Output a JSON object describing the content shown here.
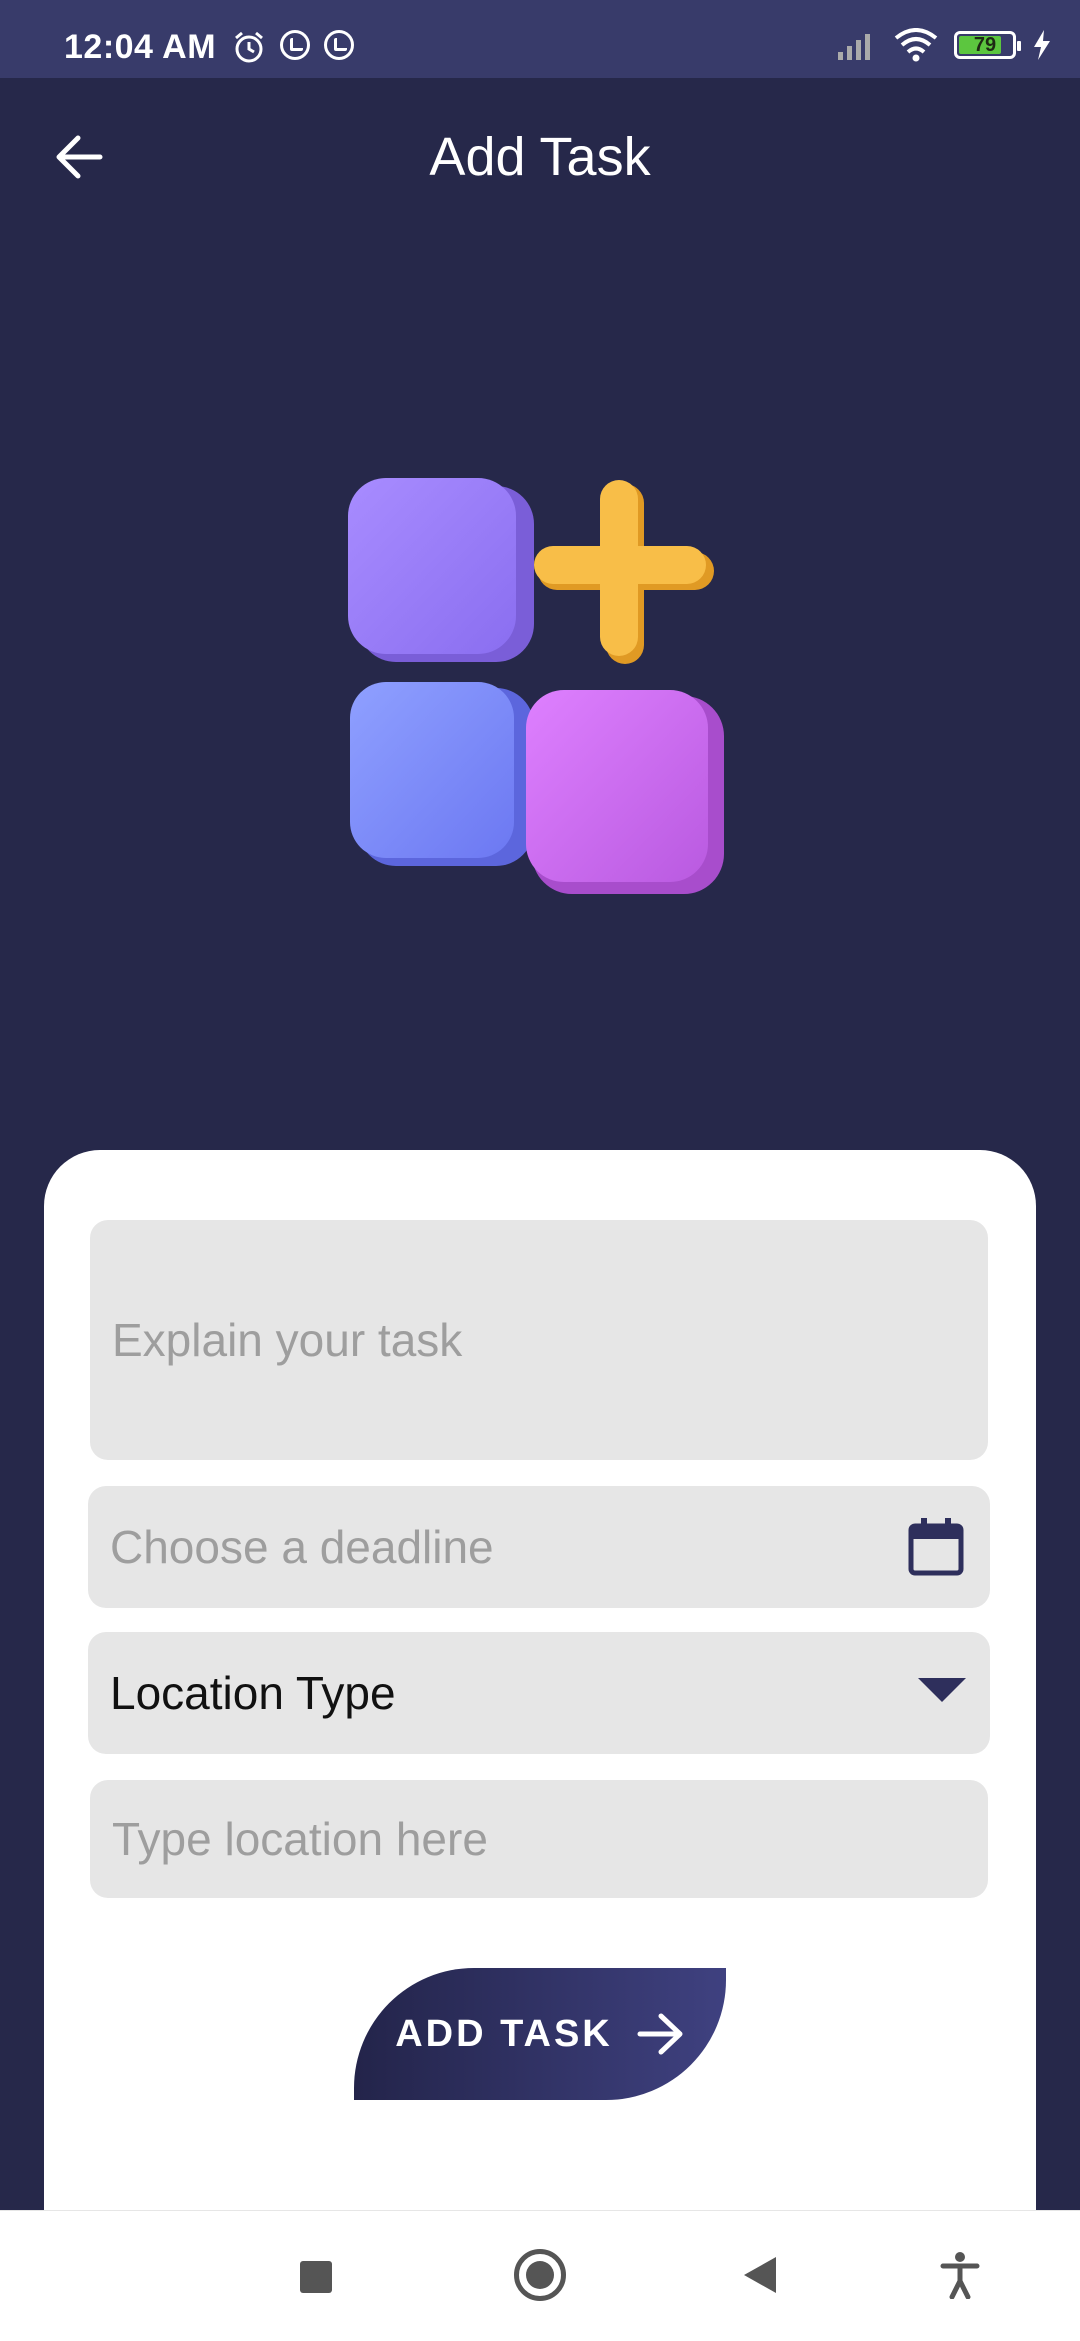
{
  "status_bar": {
    "time": "12:04 AM",
    "battery_level": "79",
    "icons": [
      "alarm-icon",
      "sync-icon",
      "sync-icon",
      "signal-icon",
      "wifi-icon",
      "battery-icon",
      "charging-icon"
    ]
  },
  "header": {
    "title": "Add Task",
    "back_icon": "arrow-left-icon"
  },
  "illustration": {
    "name": "add-task-blocks-illustration",
    "colors": {
      "purple": "#9b7cf7",
      "blue": "#7f8ff7",
      "pink": "#cf6cf0",
      "plus": "#f7b940"
    }
  },
  "form": {
    "task_placeholder": "Explain your task",
    "deadline_placeholder": "Choose a deadline",
    "location_type_value": "Location Type",
    "location_placeholder": "Type location here",
    "submit_label": "ADD TASK"
  },
  "nav_bar": {
    "buttons": [
      "recent-apps",
      "home",
      "back",
      "accessibility"
    ]
  },
  "colors": {
    "background": "#26284a",
    "status_bar": "#383b6a",
    "field": "#e6e6e6",
    "accent": "#2e2f5c"
  }
}
